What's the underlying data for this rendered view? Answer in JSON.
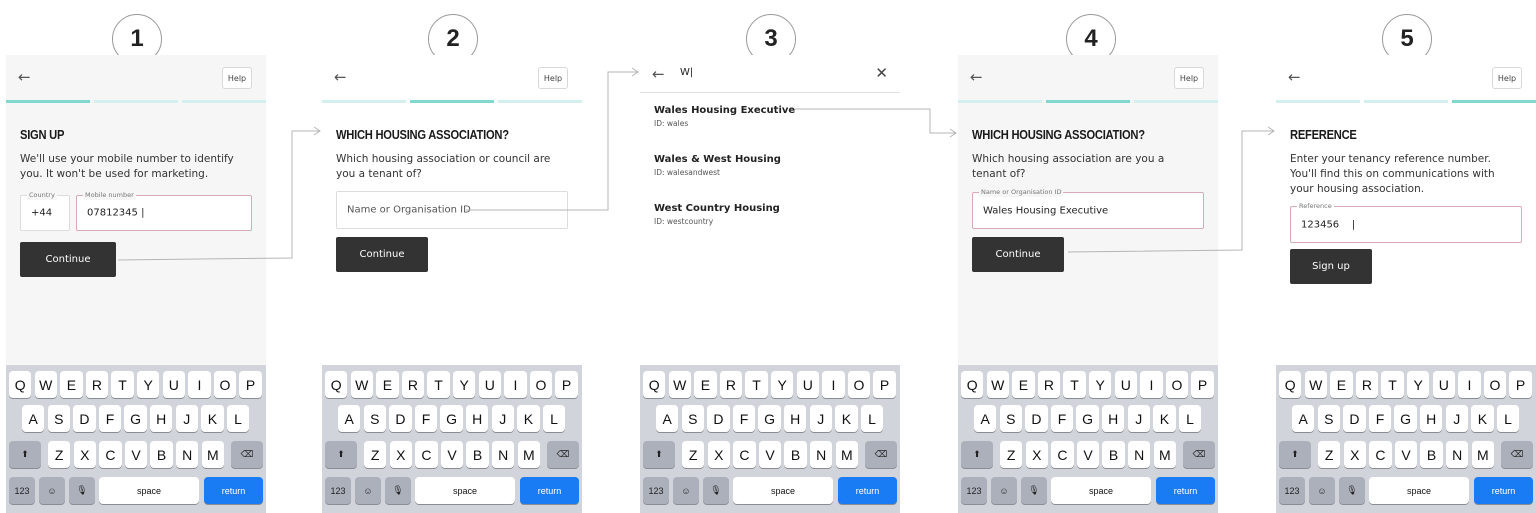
{
  "steps": [
    {
      "number": "1",
      "variant": "form",
      "back_icon": "←",
      "help_label": "Help",
      "progress_active": 0,
      "title": "SIGN UP",
      "description": "We'll use your mobile number to identify you. It won't be used for marketing.",
      "country_label": "Country",
      "country_value": "+44",
      "mobile_label": "Mobile number",
      "mobile_value": "07812345 |",
      "button_label": "Continue"
    },
    {
      "number": "2",
      "variant": "form",
      "back_icon": "←",
      "help_label": "Help",
      "progress_active": 1,
      "title": "WHICH HOUSING ASSOCIATION?",
      "description": "Which housing association or council are you a tenant of?",
      "input_placeholder": "Name or Organisation ID",
      "button_label": "Continue"
    },
    {
      "number": "3",
      "variant": "search",
      "back_icon": "←",
      "search_value": "W|",
      "close_icon": "✕",
      "results": [
        {
          "name": "Wales Housing Executive",
          "id": "ID: wales"
        },
        {
          "name": "Wales & West Housing",
          "id": "ID: walesandwest"
        },
        {
          "name": "West Country Housing",
          "id": "ID: westcountry"
        }
      ]
    },
    {
      "number": "4",
      "variant": "form",
      "back_icon": "←",
      "help_label": "Help",
      "progress_active": 1,
      "title": "WHICH HOUSING ASSOCIATION?",
      "description": "Which housing association are you a tenant of?",
      "input_label": "Name or Organisation ID",
      "input_value": "Wales Housing Executive",
      "button_label": "Continue"
    },
    {
      "number": "5",
      "variant": "form",
      "back_icon": "←",
      "help_label": "Help",
      "progress_active": 2,
      "title": "REFERENCE",
      "description": "Enter your tenancy reference number. You'll find this on communications with your housing association.",
      "input_label": "Reference",
      "input_value": "123456    |",
      "button_label": "Sign up"
    }
  ],
  "keyboard": {
    "row1": [
      "Q",
      "W",
      "E",
      "R",
      "T",
      "Y",
      "U",
      "I",
      "O",
      "P"
    ],
    "row2": [
      "A",
      "S",
      "D",
      "F",
      "G",
      "H",
      "J",
      "K",
      "L"
    ],
    "row3": [
      "Z",
      "X",
      "C",
      "V",
      "B",
      "N",
      "M"
    ],
    "shift_icon": "⬆",
    "delete_icon": "⌫",
    "numbers_label": "123",
    "emoji_icon": "☺",
    "mic_icon": "🎙",
    "space_label": "space",
    "return_label": "return"
  },
  "colors": {
    "progress_active": "#7fd9cf",
    "progress_inactive": "#d4f0ee",
    "input_border_active": "#d9aab9",
    "button_bg": "#333333",
    "return_key": "#1a7cf5"
  }
}
